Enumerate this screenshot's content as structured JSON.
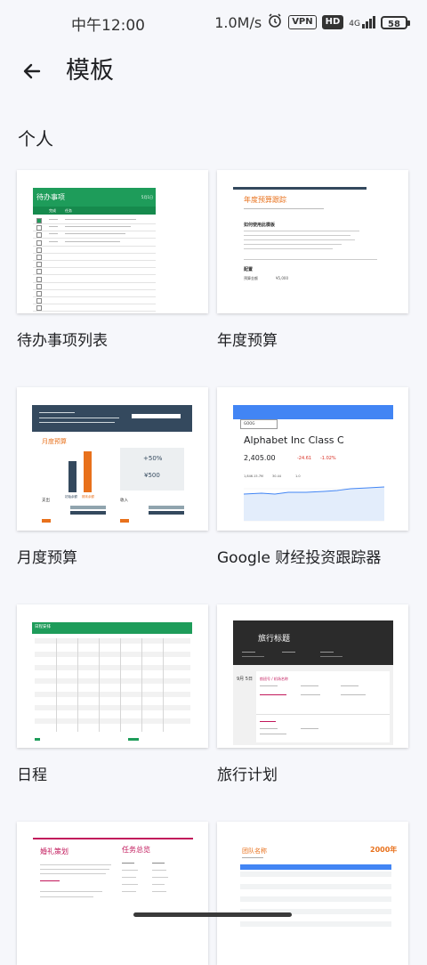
{
  "status_bar": {
    "time": "中午12:00",
    "net_speed": "1.0M/s",
    "vpn": "VPN",
    "hd": "HD",
    "signal": "4G",
    "battery": "58"
  },
  "header": {
    "title": "模板"
  },
  "section": {
    "title": "个人"
  },
  "templates": [
    {
      "label": "待办事项列表",
      "thumb": {
        "heading": "待办事项",
        "corner": "5月1日",
        "col_done": "完成",
        "col_task": "任务",
        "row_date": "1月1日"
      }
    },
    {
      "label": "年度预算",
      "thumb": {
        "heading": "年度预算跟踪",
        "sub1": "如何使用此模板",
        "sub2": "配置",
        "field": "预算金额",
        "amount": "¥5,000"
      }
    },
    {
      "label": "月度预算",
      "thumb": {
        "heading": "月度预算",
        "pct": "+50%",
        "amount": "¥500",
        "bar_a": "初始余额",
        "bar_b": "期末余额",
        "col1": "支出",
        "col2": "收入"
      }
    },
    {
      "label": "Google 财经投资跟踪器",
      "thumb": {
        "ticker": "GOOG",
        "company": "Alphabet Inc Class C",
        "price": "2,405.00",
        "change": "-24.61",
        "change_pct": "-1.02%",
        "volume": "1,846.15.7M",
        "pe": "30.44",
        "beta": "1.0"
      }
    },
    {
      "label": "日程",
      "thumb": {
        "heading": "日程安排"
      }
    },
    {
      "label": "旅行计划",
      "thumb": {
        "heading": "旅行标题",
        "dates": "9月 5日",
        "flight": "航班号 / 机场名称"
      }
    },
    {
      "label": "婚礼策划",
      "thumb": {
        "heading": "婚礼策划",
        "list": "任务总览"
      }
    },
    {
      "label": "团队名称",
      "thumb": {
        "heading": "团队名称",
        "year": "2000年"
      }
    }
  ],
  "colors": {
    "green": "#1e9c5a",
    "navy": "#34495e",
    "orange": "#e8711c",
    "blue": "#4285f4",
    "magenta": "#c2185b",
    "dark": "#2b2b2b"
  }
}
